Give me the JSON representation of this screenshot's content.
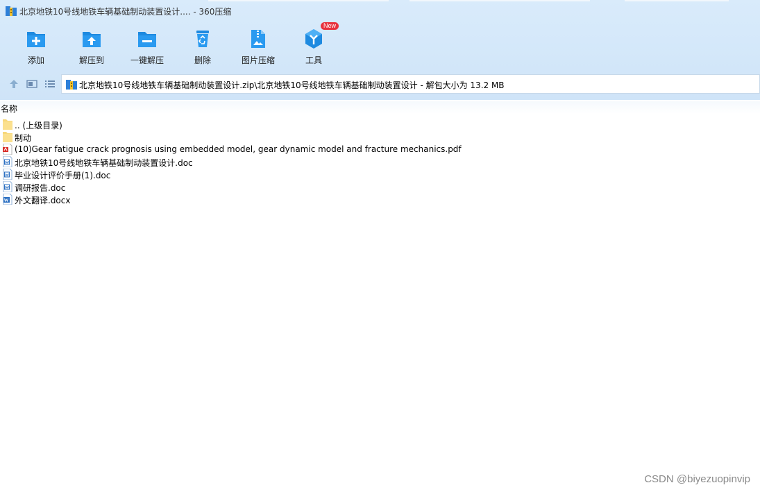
{
  "window": {
    "title": "北京地铁10号线地铁车辆基础制动装置设计....  - 360压缩"
  },
  "toolbar": {
    "buttons": [
      {
        "label": "添加",
        "icon": "add-folder-icon"
      },
      {
        "label": "解压到",
        "icon": "extract-to-icon"
      },
      {
        "label": "一键解压",
        "icon": "one-click-extract-icon"
      },
      {
        "label": "删除",
        "icon": "recycle-bin-icon"
      },
      {
        "label": "图片压缩",
        "icon": "image-compress-icon"
      },
      {
        "label": "工具",
        "icon": "tools-icon"
      }
    ],
    "new_badge": "New"
  },
  "nav": {
    "path": "北京地铁10号线地铁车辆基础制动装置设计.zip\\北京地铁10号线地铁车辆基础制动装置设计 - 解包大小为 13.2 MB"
  },
  "columns": {
    "name": "名称"
  },
  "files": [
    {
      "name": ".. (上级目录)",
      "type": "folder"
    },
    {
      "name": "制动",
      "type": "folder"
    },
    {
      "name": "(10)Gear fatigue crack prognosis using embedded model, gear dynamic model and fracture mechanics.pdf",
      "type": "pdf"
    },
    {
      "name": "北京地铁10号线地铁车辆基础制动装置设计.doc",
      "type": "doc"
    },
    {
      "name": "毕业设计评价手册(1).doc",
      "type": "doc"
    },
    {
      "name": "调研报告.doc",
      "type": "doc"
    },
    {
      "name": "外文翻译.docx",
      "type": "docx"
    }
  ],
  "watermark": "CSDN @biyezuopinvip",
  "colors": {
    "accent_blue": "#1e8ae0",
    "badge_red": "#e8323c",
    "folder_yellow": "#f7d77a"
  }
}
